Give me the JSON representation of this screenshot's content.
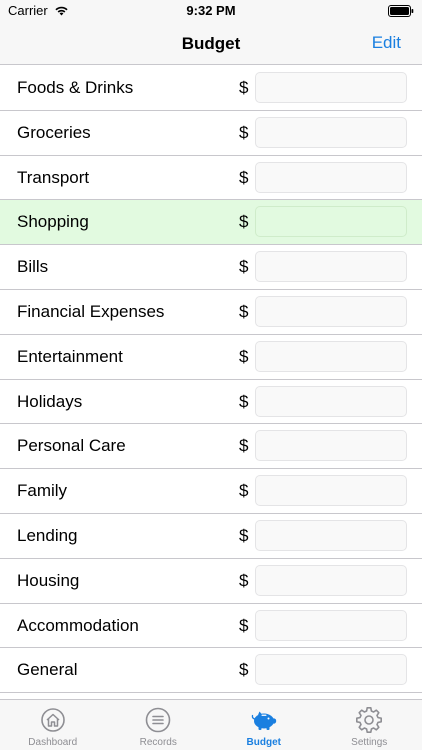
{
  "status_bar": {
    "carrier": "Carrier",
    "time": "9:32 PM"
  },
  "nav": {
    "title": "Budget",
    "edit_label": "Edit"
  },
  "currency_symbol": "$",
  "categories": [
    {
      "label": "Foods & Drinks",
      "value": ""
    },
    {
      "label": "Groceries",
      "value": ""
    },
    {
      "label": "Transport",
      "value": ""
    },
    {
      "label": "Shopping",
      "value": "",
      "highlighted": true
    },
    {
      "label": "Bills",
      "value": ""
    },
    {
      "label": "Financial Expenses",
      "value": ""
    },
    {
      "label": "Entertainment",
      "value": ""
    },
    {
      "label": "Holidays",
      "value": ""
    },
    {
      "label": "Personal Care",
      "value": ""
    },
    {
      "label": "Family",
      "value": ""
    },
    {
      "label": "Lending",
      "value": ""
    },
    {
      "label": "Housing",
      "value": ""
    },
    {
      "label": "Accommodation",
      "value": ""
    },
    {
      "label": "General",
      "value": ""
    }
  ],
  "tabs": [
    {
      "label": "Dashboard",
      "icon": "home-icon"
    },
    {
      "label": "Records",
      "icon": "list-icon"
    },
    {
      "label": "Budget",
      "icon": "piggy-bank-icon",
      "active": true
    },
    {
      "label": "Settings",
      "icon": "gear-icon"
    }
  ],
  "colors": {
    "accent": "#1a7fe0",
    "inactive": "#8e8e93",
    "highlight_row": "#e2fae0"
  }
}
